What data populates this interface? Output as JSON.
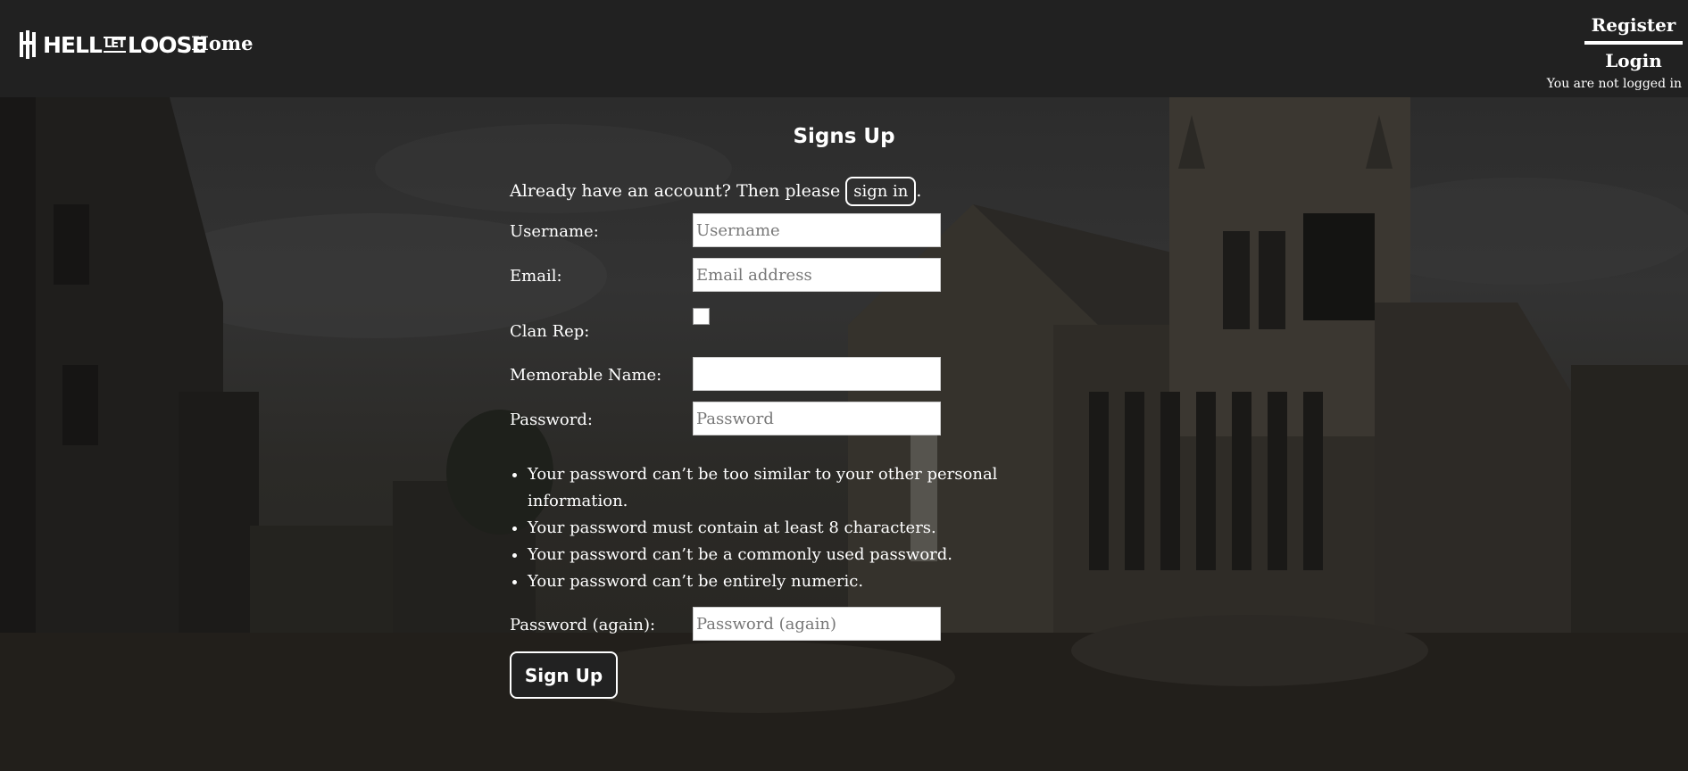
{
  "nav": {
    "brand": {
      "word1": "HELL",
      "word2": "LET",
      "word3": "LOOSE"
    },
    "home": "Home",
    "register": "Register",
    "login": "Login",
    "status": "You are not logged in"
  },
  "page": {
    "title": "Signs Up",
    "already_text": "Already have an account? Then please",
    "sign_in_link": "sign in",
    "period": "."
  },
  "form": {
    "username": {
      "label": "Username:",
      "placeholder": "Username",
      "value": ""
    },
    "email": {
      "label": "Email:",
      "placeholder": "Email address",
      "value": ""
    },
    "clan_rep": {
      "label": "Clan Rep:",
      "checked": false
    },
    "memorable_name": {
      "label": "Memorable Name:",
      "placeholder": "",
      "value": ""
    },
    "password": {
      "label": "Password:",
      "placeholder": "Password",
      "value": ""
    },
    "password_help": [
      "Your password can’t be too similar to your other personal information.",
      "Your password must contain at least 8 characters.",
      "Your password can’t be a commonly used password.",
      "Your password can’t be entirely numeric."
    ],
    "password_again": {
      "label": "Password (again):",
      "placeholder": "Password (again)",
      "value": ""
    },
    "submit_label": "Sign Up"
  },
  "colors": {
    "navbar": "#212121",
    "text": "#ffffff",
    "input_bg": "#ffffff",
    "button_bg": "#222222"
  }
}
